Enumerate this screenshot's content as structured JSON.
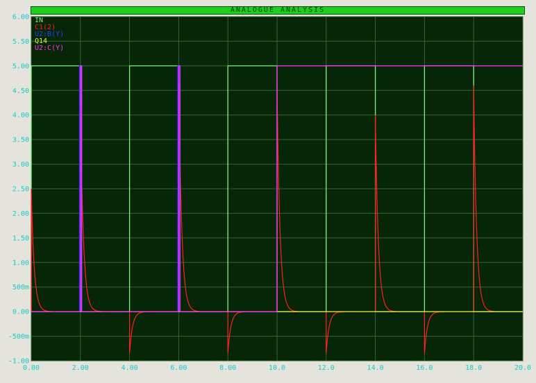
{
  "window": {
    "title": "ANALOGUE ANALYSIS"
  },
  "colors": {
    "plot_bg": "#072607",
    "grid": "#2f6a2f",
    "axis_text": "#18c8c8",
    "title_bar": "#1fcf1f",
    "frame": "#e4e4dc"
  },
  "chart_data": {
    "type": "line",
    "title": "ANALOGUE ANALYSIS",
    "xlabel": "",
    "ylabel": "",
    "xlim": [
      0,
      20
    ],
    "ylim": [
      -1,
      6
    ],
    "grid": true,
    "legend_placement": "top-left",
    "x_ticks": [
      "0.00",
      "2.00",
      "4.00",
      "6.00",
      "8.00",
      "10.0",
      "12.0",
      "14.0",
      "16.0",
      "18.0",
      "20.0"
    ],
    "y_ticks": [
      {
        "value": 6.0,
        "label": "6.00"
      },
      {
        "value": 5.5,
        "label": "5.50"
      },
      {
        "value": 5.0,
        "label": "5.00"
      },
      {
        "value": 4.5,
        "label": "4.50"
      },
      {
        "value": 4.0,
        "label": "4.00"
      },
      {
        "value": 3.5,
        "label": "3.50"
      },
      {
        "value": 3.0,
        "label": "3.00"
      },
      {
        "value": 2.5,
        "label": "2.50"
      },
      {
        "value": 2.0,
        "label": "2.00"
      },
      {
        "value": 1.5,
        "label": "1.50"
      },
      {
        "value": 1.0,
        "label": "1.00"
      },
      {
        "value": 0.5,
        "label": "500m"
      },
      {
        "value": 0.0,
        "label": "0.00"
      },
      {
        "value": -0.5,
        "label": "-500m"
      },
      {
        "value": -1.0,
        "label": "-1.00"
      }
    ],
    "series": [
      {
        "name": "IN",
        "color": "#7ef07e",
        "kind": "square",
        "high": 5,
        "low": 0,
        "rising_edges": [
          0,
          4,
          8,
          12,
          16
        ],
        "falling_edges": [
          2,
          6,
          10,
          14,
          18
        ]
      },
      {
        "name": "C1(2)",
        "color": "#ff2020",
        "kind": "rc_spikes",
        "tau": 0.12,
        "spikes": [
          {
            "t": 0,
            "peak": 2.5
          },
          {
            "t": 2,
            "peak": 4.2
          },
          {
            "t": 6,
            "peak": 4.8
          },
          {
            "t": 10,
            "peak": 4.6
          },
          {
            "t": 14,
            "peak": 4.0
          },
          {
            "t": 18,
            "peak": 4.6
          },
          {
            "t": 4,
            "peak": -0.85
          },
          {
            "t": 8,
            "peak": -0.85
          },
          {
            "t": 12,
            "peak": -0.85
          },
          {
            "t": 16,
            "peak": -0.85
          }
        ]
      },
      {
        "name": "U2:B(Y)",
        "color": "#2040ff",
        "kind": "pulses",
        "high": 5,
        "low": 0,
        "pulses": [
          [
            1.97,
            2.05
          ],
          [
            5.97,
            6.05
          ]
        ]
      },
      {
        "name": "Q14",
        "color": "#f0f040",
        "kind": "steps",
        "points": [
          [
            0,
            0
          ],
          [
            20,
            0
          ]
        ]
      },
      {
        "name": "U2:C(Y)",
        "color": "#ff30ff",
        "kind": "steps",
        "points": [
          [
            0,
            0
          ],
          [
            2.0,
            0
          ],
          [
            2.0,
            5
          ],
          [
            2.05,
            5
          ],
          [
            2.05,
            0
          ],
          [
            6.0,
            0
          ],
          [
            6.0,
            5
          ],
          [
            6.05,
            5
          ],
          [
            6.05,
            0
          ],
          [
            10,
            0
          ],
          [
            10,
            5
          ],
          [
            20,
            5
          ]
        ]
      }
    ]
  }
}
